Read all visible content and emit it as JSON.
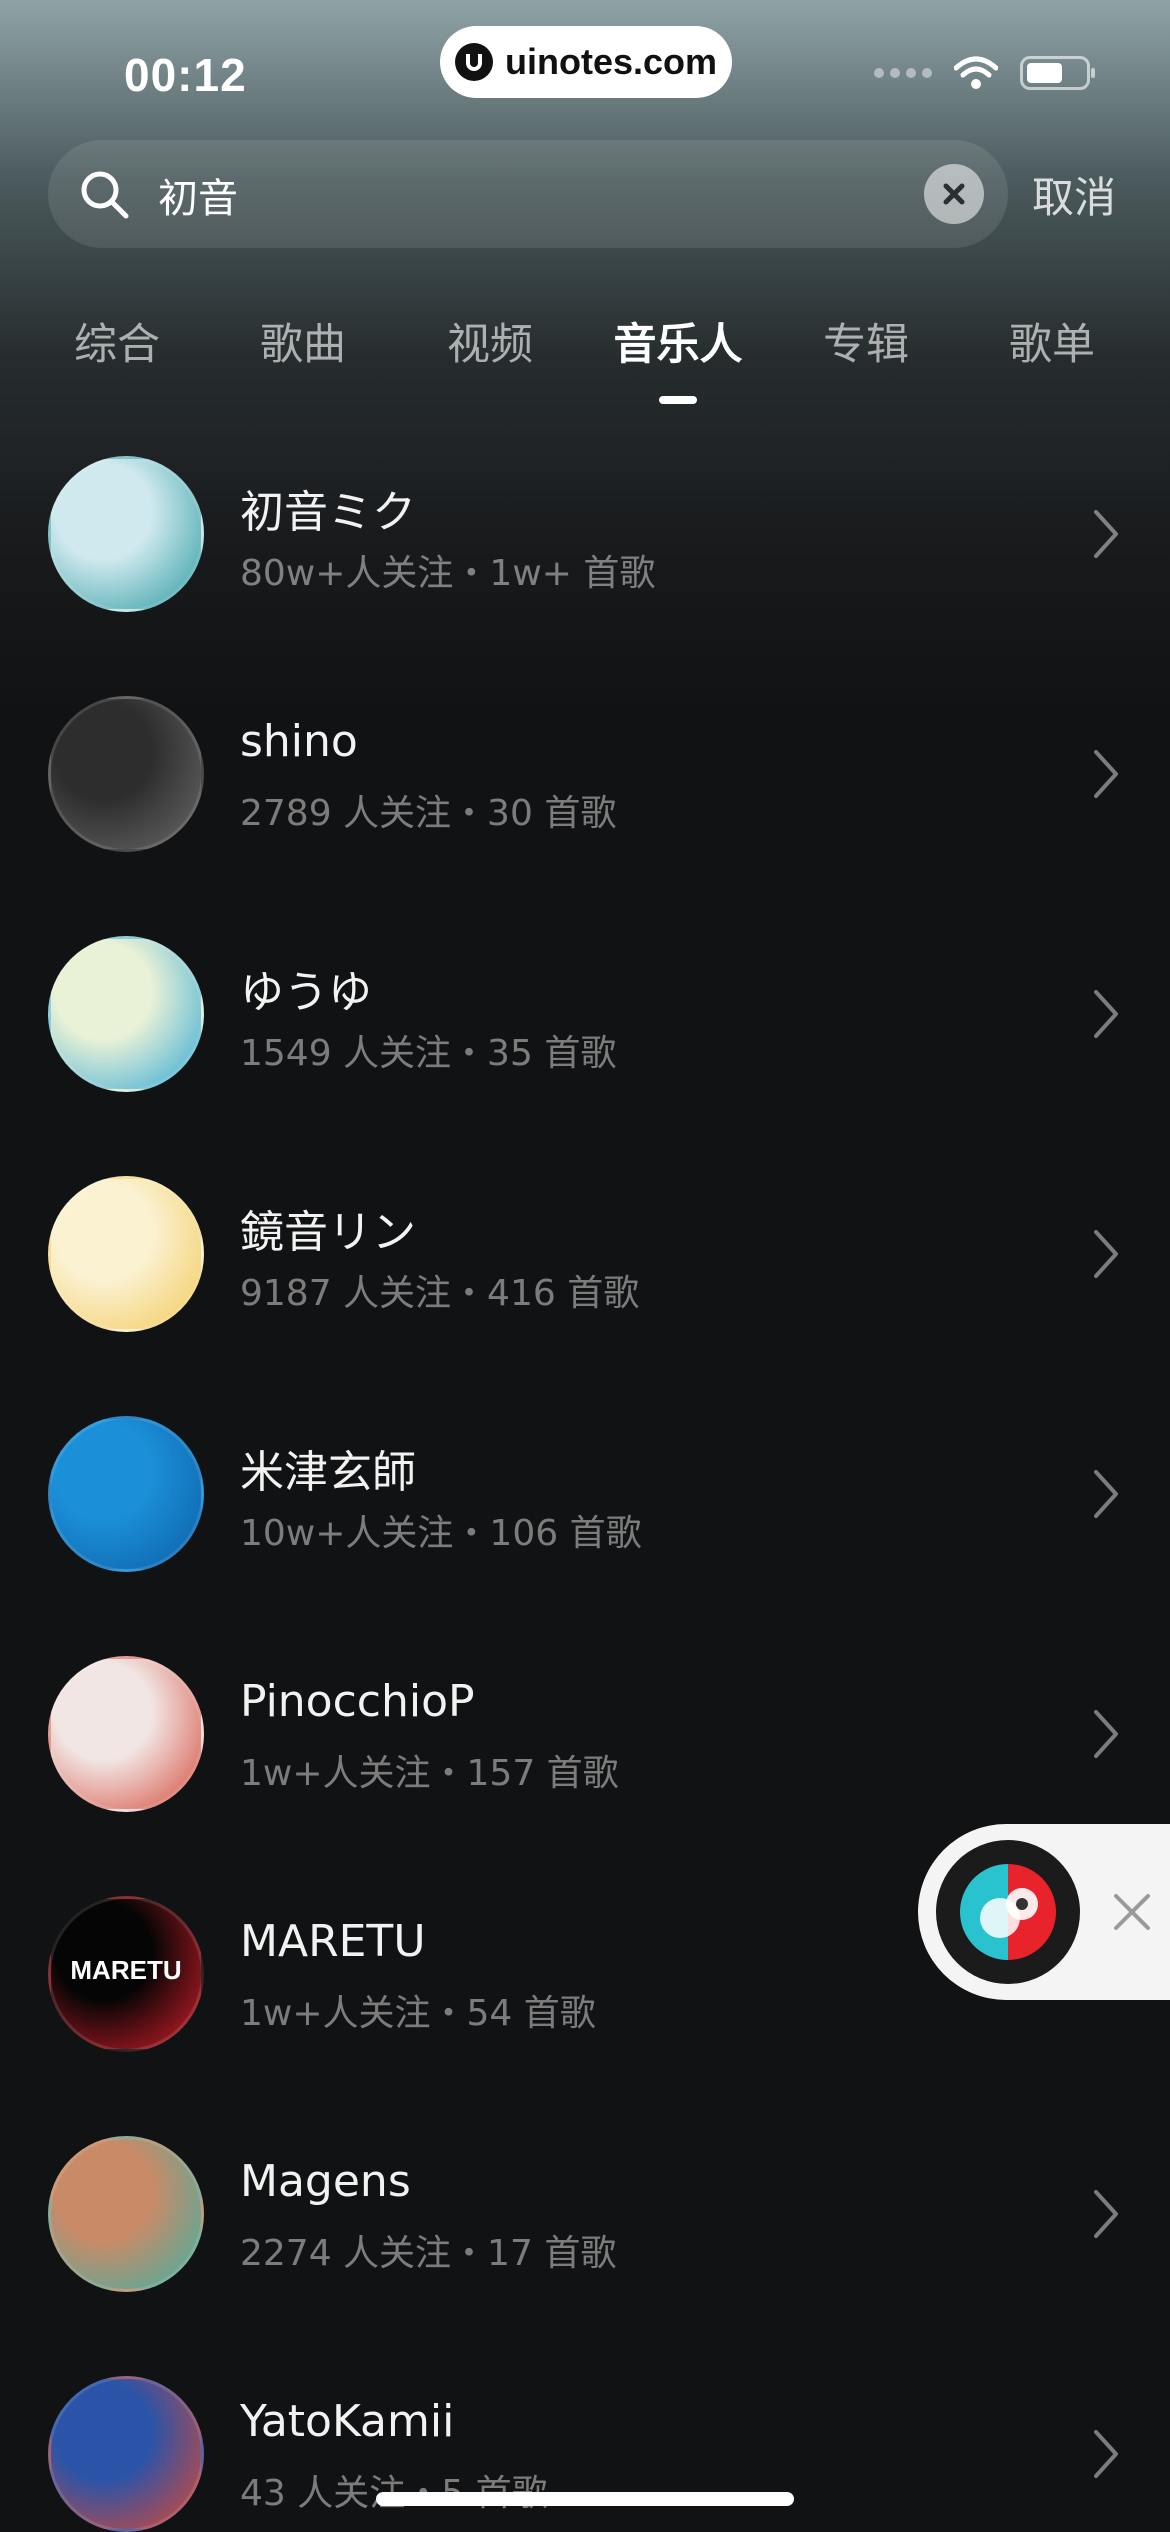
{
  "status": {
    "time": "00:12",
    "watermark": "uinotes.com"
  },
  "search": {
    "query": "初音",
    "cancel_label": "取消"
  },
  "tabs": [
    {
      "label": "综合",
      "active": false
    },
    {
      "label": "歌曲",
      "active": false
    },
    {
      "label": "视频",
      "active": false
    },
    {
      "label": "音乐人",
      "active": true
    },
    {
      "label": "专辑",
      "active": false
    },
    {
      "label": "歌单",
      "active": false
    }
  ],
  "artists": [
    {
      "name": "初音ミク",
      "meta": "80w+人关注・1w+ 首歌",
      "avatar_colors": [
        "#cfe9ee",
        "#2a9aa0"
      ]
    },
    {
      "name": "shino",
      "meta": "2789 人关注・30 首歌",
      "avatar_colors": [
        "#2d2d2d",
        "#6a6a6a"
      ]
    },
    {
      "name": "ゆうゆ",
      "meta": "1549 人关注・35 首歌",
      "avatar_colors": [
        "#e9f1d6",
        "#2fa7d6"
      ]
    },
    {
      "name": "鏡音リン",
      "meta": "9187 人关注・416 首歌",
      "avatar_colors": [
        "#fbf2d2",
        "#f2c95a"
      ]
    },
    {
      "name": "米津玄師",
      "meta": "10w+人关注・106 首歌",
      "avatar_colors": [
        "#1b8fd8",
        "#0c5fa6"
      ]
    },
    {
      "name": "PinocchioP",
      "meta": "1w+人关注・157 首歌",
      "avatar_colors": [
        "#f1e6e4",
        "#d54a3a"
      ]
    },
    {
      "name": "MARETU",
      "meta": "1w+人关注・54 首歌",
      "avatar_colors": [
        "#050505",
        "#d81e2b"
      ],
      "avatar_text": "MARETU"
    },
    {
      "name": "Magens",
      "meta": "2274 人关注・17 首歌",
      "avatar_colors": [
        "#c98a67",
        "#3db3a5"
      ]
    },
    {
      "name": "YatoKamii",
      "meta": "43 人关注・5 首歌",
      "avatar_colors": [
        "#2b54a8",
        "#e0472e"
      ]
    }
  ]
}
